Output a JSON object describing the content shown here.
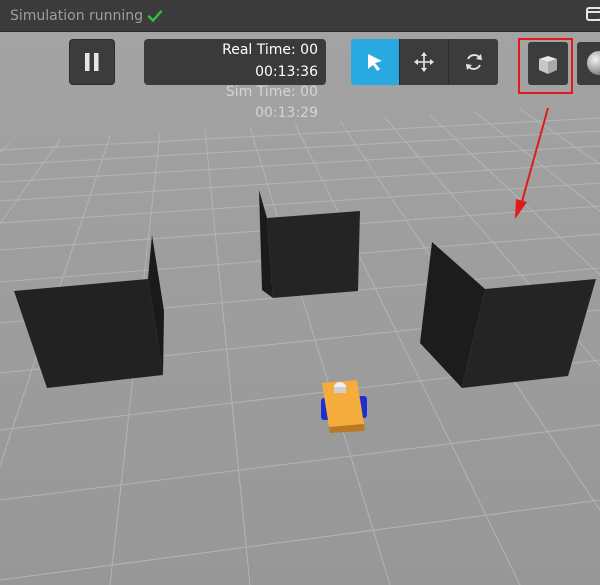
{
  "header": {
    "status": "Simulation running"
  },
  "time": {
    "real_label": "Real Time: 00",
    "real_value": "00:13:36",
    "sim_label": "Sim Time: 00",
    "sim_value": "00:13:29"
  },
  "toolbar": {
    "tools": [
      "select-mode",
      "translate-mode",
      "rotate-mode",
      "box-shape",
      "sphere-shape"
    ],
    "active_tool": "select-mode"
  },
  "colors": {
    "accent": "#29a9e1",
    "status_ok": "#3bbf3b",
    "highlight": "#e11b1b",
    "ground": "#9a9a9a",
    "grid": "#b4b4b4",
    "obstacle": "#232323",
    "robot_body": "#f2a93b",
    "robot_wheels": "#1e2fd0"
  }
}
